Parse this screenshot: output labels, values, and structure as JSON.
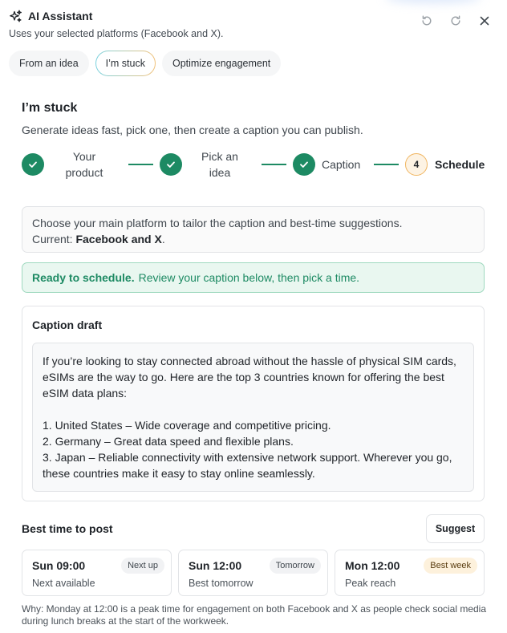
{
  "header": {
    "title": "AI Assistant",
    "subtitle": "Uses your selected platforms (Facebook and X)."
  },
  "tabs": [
    {
      "label": "From an idea",
      "active": false
    },
    {
      "label": "I’m stuck",
      "active": true
    },
    {
      "label": "Optimize engagement",
      "active": false
    }
  ],
  "section": {
    "title": "I’m stuck",
    "description": "Generate ideas fast, pick one, then create a caption you can publish."
  },
  "steps": [
    {
      "label_line1": "Your",
      "label_line2": "product",
      "status": "done"
    },
    {
      "label_line1": "Pick an",
      "label_line2": "idea",
      "status": "done"
    },
    {
      "label": "Caption",
      "status": "done"
    },
    {
      "number": "4",
      "label": "Schedule",
      "status": "current"
    }
  ],
  "platform": {
    "text": "Choose your main platform to tailor the caption and best-time suggestions.",
    "current_label": "Current:",
    "current_value": "Facebook and X",
    "period": "."
  },
  "ready": {
    "strong": "Ready to schedule.",
    "text": "Review your caption below, then pick a time."
  },
  "caption": {
    "label": "Caption draft",
    "text": "If you’re looking to stay connected abroad without the hassle of physical SIM cards, eSIMs are the way to go. Here are the top 3 countries known for offering the best eSIM data plans:\n\n1. United States – Wide coverage and competitive pricing.\n2. Germany – Great data speed and flexible plans.\n3. Japan – Reliable connectivity with extensive network support. Wherever you go, these countries make it easy to stay online seamlessly."
  },
  "best_time": {
    "label": "Best time to post",
    "suggest_label": "Suggest",
    "slots": [
      {
        "time": "Sun 09:00",
        "badge": "Next up",
        "sub": "Next available"
      },
      {
        "time": "Sun 12:00",
        "badge": "Tomorrow",
        "sub": "Best tomorrow"
      },
      {
        "time": "Mon 12:00",
        "badge": "Best week",
        "sub": "Peak reach"
      }
    ],
    "why": "Why: Monday at 12:00 is a peak time for engagement on both Facebook and X as people check social media during lunch breaks at the start of the workweek."
  },
  "colors": {
    "accent_green": "#1d8a63",
    "pending_step": "#f0b560",
    "ready_bg": "#e9f7f0"
  }
}
